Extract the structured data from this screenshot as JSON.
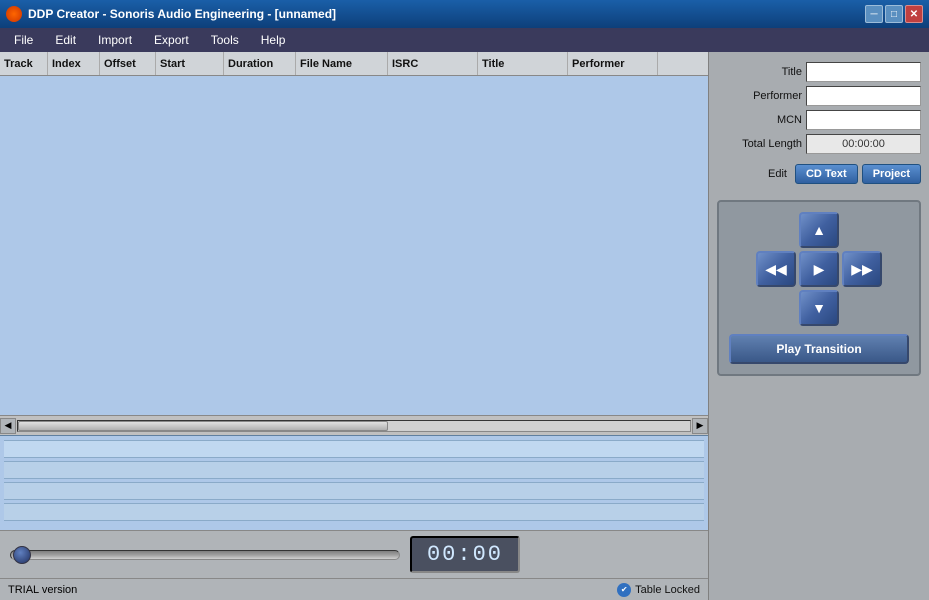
{
  "window": {
    "title": "DDP Creator - Sonoris Audio Engineering - [unnamed]",
    "icon": "●"
  },
  "titlebar": {
    "min_label": "─",
    "max_label": "□",
    "close_label": "✕"
  },
  "menu": {
    "items": [
      {
        "label": "File"
      },
      {
        "label": "Edit"
      },
      {
        "label": "Import"
      },
      {
        "label": "Export"
      },
      {
        "label": "Tools"
      },
      {
        "label": "Help"
      }
    ]
  },
  "table": {
    "columns": [
      {
        "label": "Track",
        "key": "track"
      },
      {
        "label": "Index",
        "key": "index"
      },
      {
        "label": "Offset",
        "key": "offset"
      },
      {
        "label": "Start",
        "key": "start"
      },
      {
        "label": "Duration",
        "key": "duration"
      },
      {
        "label": "File Name",
        "key": "filename"
      },
      {
        "label": "ISRC",
        "key": "isrc"
      },
      {
        "label": "Title",
        "key": "title"
      },
      {
        "label": "Performer",
        "key": "performer"
      }
    ],
    "rows": []
  },
  "right_panel": {
    "fields": {
      "title_label": "Title",
      "title_value": "",
      "performer_label": "Performer",
      "performer_value": "",
      "mcn_label": "MCN",
      "mcn_value": "",
      "total_length_label": "Total Length",
      "total_length_value": "00:00:00"
    },
    "edit": {
      "label": "Edit",
      "cd_text_btn": "CD Text",
      "project_btn": "Project"
    },
    "transport": {
      "up_arrow": "▲",
      "left_arrow": "◀◀",
      "play_arrow": "▶",
      "right_arrow": "▶▶",
      "down_arrow": "▼",
      "play_transition_btn": "Play Transition"
    }
  },
  "transport_bar": {
    "time_display": "00:00"
  },
  "status_bar": {
    "trial_text": "TRIAL version",
    "table_locked_text": "Table Locked"
  }
}
